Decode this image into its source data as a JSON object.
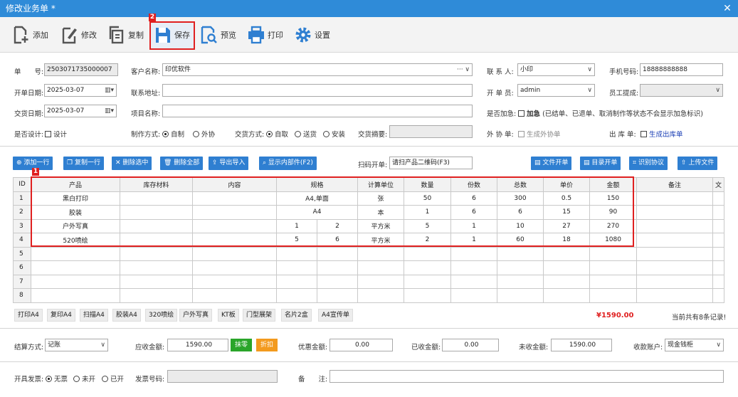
{
  "window": {
    "title": "修改业务单 *",
    "close": "✕"
  },
  "toolbar": {
    "add": "添加",
    "edit": "修改",
    "copy": "复制",
    "save": "保存",
    "preview": "预览",
    "print": "打印",
    "settings": "设置",
    "badge_save": "2"
  },
  "form": {
    "order_no_label": "单　　号:",
    "order_no": "2503071735000007",
    "customer_label": "客户名称:",
    "customer": "印优软件",
    "contact_label": "联 系 人:",
    "contact": "小印",
    "phone_label": "手机号码:",
    "phone": "18888888888",
    "open_date_label": "开单日期:",
    "open_date": "2025-03-07",
    "address_label": "联系地址:",
    "address": "",
    "opener_label": "开 单 员:",
    "opener": "admin",
    "commission_label": "员工提成:",
    "commission": "",
    "delivery_date_label": "交货日期:",
    "delivery_date": "2025-03-07",
    "project_label": "项目名称:",
    "project": "",
    "urgent_label": "是否加急:",
    "urgent_text": "加急",
    "urgent_note": "(已结单、已退单、取消制作等状态不会显示加急标识)",
    "design_label": "是否设计:",
    "design_text": "设计",
    "make_label": "制作方式:",
    "make_opts": [
      "自制",
      "外协"
    ],
    "deliver_label": "交货方式:",
    "deliver_opts": [
      "自取",
      "送货",
      "安装"
    ],
    "summary_label": "交货摘要:",
    "outsource_label": "外 协 单:",
    "outsource_text": "生成外协单",
    "outbound_label": "出 库 单:",
    "outbound_text": "生成出库单"
  },
  "actions": {
    "add_row": "添加一行",
    "copy_row": "复制一行",
    "del_sel": "删除选中",
    "del_all": "删除全部",
    "export": "导出导入",
    "show_parts": "显示内部件(F2)",
    "scan_label": "扫码开单:",
    "scan_placeholder": "请扫产品二维码(F3)",
    "file_order": "文件开单",
    "catalog_order": "目录开单",
    "recognize": "识别协议",
    "upload": "上传文件",
    "badge_grid": "1"
  },
  "grid": {
    "headers": [
      "ID",
      "产品",
      "库存材料",
      "内容",
      "规格",
      "计算单位",
      "数量",
      "份数",
      "总数",
      "单价",
      "金额",
      "备注",
      "文"
    ],
    "rows": [
      {
        "id": "1",
        "product": "黑白打印",
        "spec": "A4,单面",
        "unit": "张",
        "qty": "50",
        "copies": "6",
        "total": "300",
        "price": "0.5",
        "amount": "150"
      },
      {
        "id": "2",
        "product": "胶装",
        "spec": "A4",
        "unit": "本",
        "qty": "1",
        "copies": "6",
        "total": "6",
        "price": "15",
        "amount": "90"
      },
      {
        "id": "3",
        "product": "户外写真",
        "spec_a": "1",
        "spec_b": "2",
        "unit": "平方米",
        "qty": "5",
        "copies": "1",
        "total": "10",
        "price": "27",
        "amount": "270"
      },
      {
        "id": "4",
        "product": "520喷绘",
        "spec_a": "5",
        "spec_b": "6",
        "unit": "平方米",
        "qty": "2",
        "copies": "1",
        "total": "60",
        "price": "18",
        "amount": "1080"
      }
    ],
    "empty_ids": [
      "5",
      "6",
      "7",
      "8"
    ]
  },
  "quick": [
    "打印A4",
    "复印A4",
    "扫描A4",
    "胶装A4",
    "320喷绘",
    "户外写真",
    "KT板",
    "门型展架",
    "名片2盒",
    "A4宣传单"
  ],
  "summary": {
    "total": "¥1590.00",
    "records": "当前共有8条记录!"
  },
  "settle": {
    "method_label": "结算方式:",
    "method": "记账",
    "receivable_label": "应收金额:",
    "receivable": "1590.00",
    "erase": "抹零",
    "discount": "折扣",
    "offer_label": "优惠金额:",
    "offer": "0.00",
    "received_label": "已收金额:",
    "received": "0.00",
    "unreceived_label": "未收金额:",
    "unreceived": "1590.00",
    "account_label": "收款账户:",
    "account": "现金钱柜"
  },
  "invoice": {
    "label": "开具发票:",
    "opts": [
      "无票",
      "未开",
      "已开"
    ],
    "no_label": "发票号码:",
    "note_label": "备　　注:"
  },
  "colors": {
    "titlebar": "#2f8bd8",
    "button_blue": "#2f7fd1",
    "highlight": "#e02020",
    "total_red": "#e02020",
    "erase_green": "#2aa52a",
    "discount_orange": "#f39a1e"
  }
}
